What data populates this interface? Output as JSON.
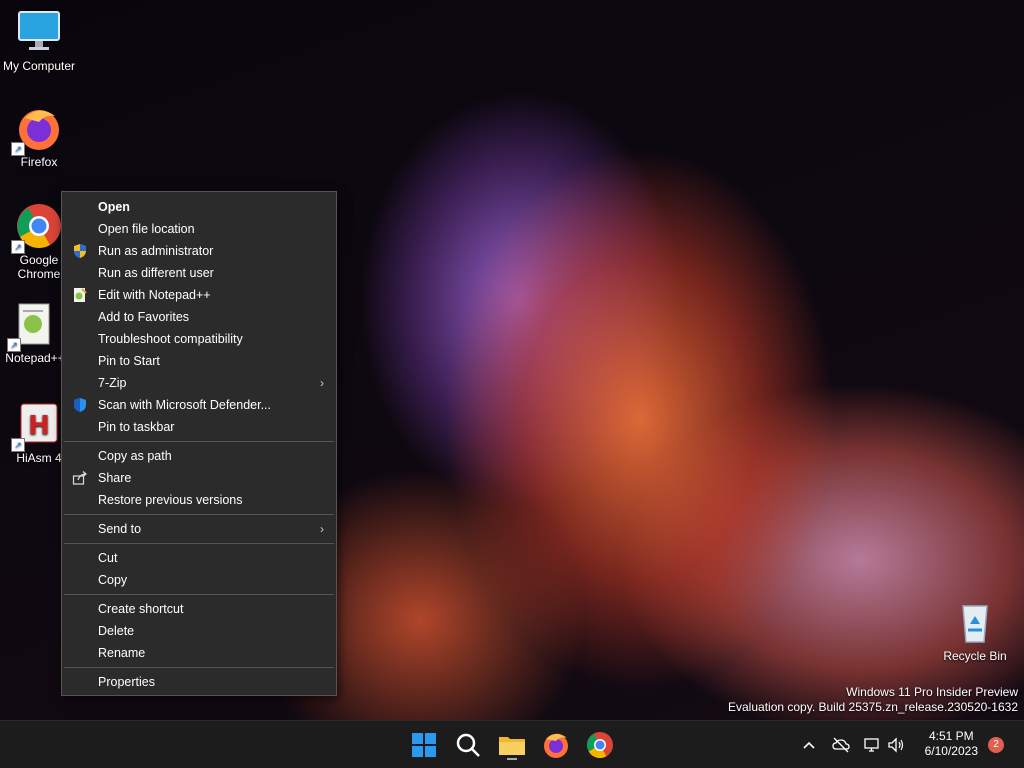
{
  "desktop_icons": [
    {
      "label": "My Computer",
      "icon": "computer-icon"
    },
    {
      "label": "Firefox",
      "icon": "firefox-icon"
    },
    {
      "label": "Google Chrome",
      "icon": "chrome-icon"
    },
    {
      "label": "Notepad++",
      "icon": "notepadpp-icon"
    },
    {
      "label": "HiAsm 4",
      "icon": "hiasm-icon"
    },
    {
      "label": "Recycle Bin",
      "icon": "recycle-bin-icon"
    }
  ],
  "context_menu": {
    "items": [
      {
        "label": "Open",
        "bold": true
      },
      {
        "label": "Open file location"
      },
      {
        "label": "Run as administrator",
        "icon": "uac-shield-icon"
      },
      {
        "label": "Run as different user"
      },
      {
        "label": "Edit with Notepad++",
        "icon": "notepadpp-icon"
      },
      {
        "label": "Add to Favorites"
      },
      {
        "label": "Troubleshoot compatibility"
      },
      {
        "label": "Pin to Start"
      },
      {
        "label": "7-Zip",
        "submenu": true
      },
      {
        "label": "Scan with Microsoft Defender...",
        "icon": "defender-shield-icon"
      },
      {
        "label": "Pin to taskbar"
      },
      {
        "label": "Copy as path"
      },
      {
        "label": "Share",
        "icon": "share-icon"
      },
      {
        "label": "Restore previous versions"
      },
      {
        "label": "Send to",
        "submenu": true
      },
      {
        "label": "Cut"
      },
      {
        "label": "Copy"
      },
      {
        "label": "Create shortcut"
      },
      {
        "label": "Delete"
      },
      {
        "label": "Rename"
      },
      {
        "label": "Properties"
      }
    ]
  },
  "watermark": {
    "line1": "Windows 11 Pro Insider Preview",
    "line2": "Evaluation copy. Build 25375.zn_release.230520-1632"
  },
  "taskbar": {
    "apps": [
      "start-icon",
      "search-icon",
      "file-explorer-icon",
      "firefox-icon",
      "chrome-icon"
    ],
    "tray_icons": [
      "chevron-up-icon",
      "cloud-off-icon",
      "network-icon",
      "volume-icon"
    ],
    "time": "4:51 PM",
    "date": "6/10/2023",
    "notification_count": "2"
  }
}
